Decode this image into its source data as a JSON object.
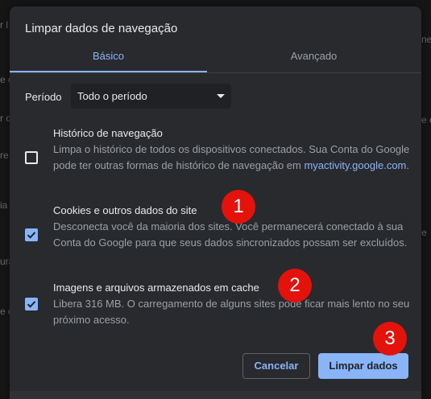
{
  "colors": {
    "dialog_bg": "#292a2d",
    "accent": "#8ab4f8",
    "text_primary": "#e8eaed",
    "text_secondary": "#9aa0a6",
    "marker": "#e3120b"
  },
  "background_fragments": {
    "left": [
      "r l",
      "e c",
      "r o",
      "re",
      "ia",
      "ura",
      "e o"
    ],
    "right": [
      "ne",
      "e e",
      "e"
    ]
  },
  "dialog": {
    "title": "Limpar dados de navegação",
    "tabs": [
      {
        "label": "Básico",
        "active": true
      },
      {
        "label": "Avançado",
        "active": false
      }
    ],
    "period": {
      "label": "Período",
      "selected": "Todo o período"
    },
    "options": [
      {
        "title": "Histórico de navegação",
        "description": "Limpa o histórico de todos os dispositivos conectados. Sua Conta do Google pode ter outras formas de histórico de navegação em",
        "link": "myactivity.google.com",
        "link_suffix": ".",
        "checked": false
      },
      {
        "title": "Cookies e outros dados do site",
        "description": "Desconecta você da maioria dos sites. Você permanecerá conectado à sua Conta do Google para que seus dados sincronizados possam ser excluídos.",
        "checked": true
      },
      {
        "title": "Imagens e arquivos armazenados em cache",
        "description": "Libera 316 MB. O carregamento de alguns sites pode ficar mais lento no seu próximo acesso.",
        "checked": true
      }
    ],
    "buttons": {
      "cancel": "Cancelar",
      "clear": "Limpar dados"
    }
  },
  "markers": [
    "1",
    "2",
    "3"
  ]
}
